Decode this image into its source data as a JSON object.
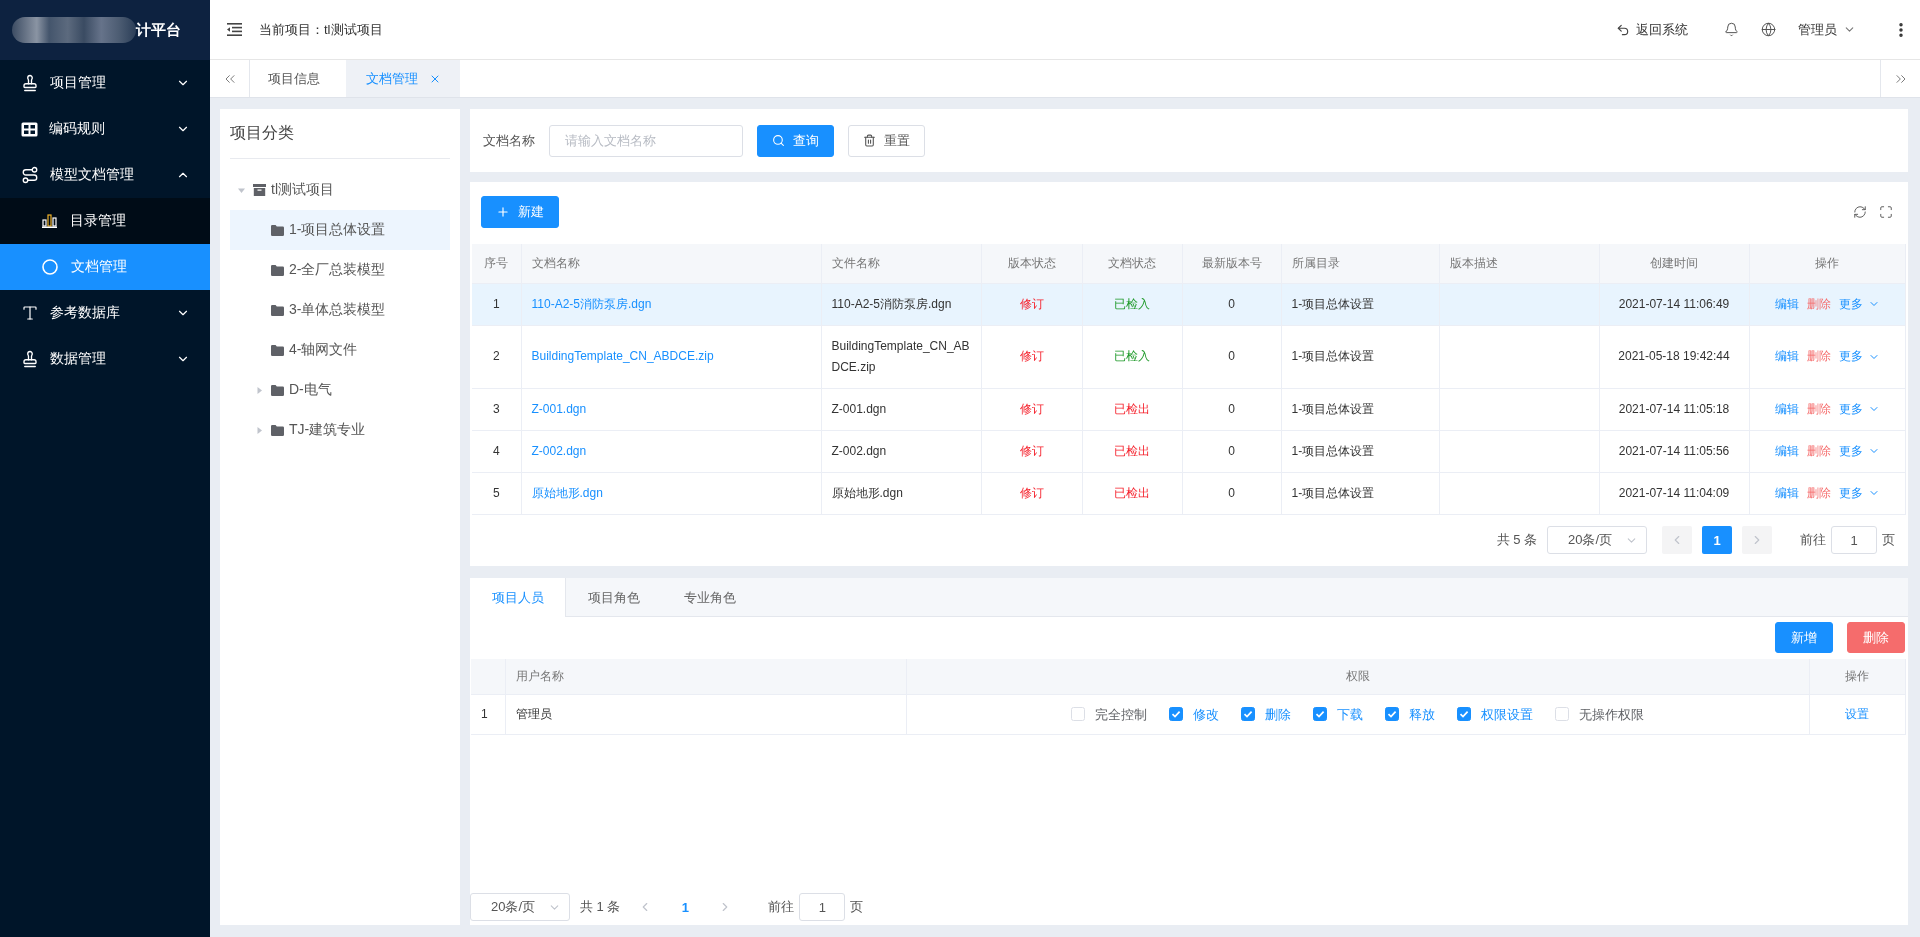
{
  "sidebar": {
    "logo_text": "计平台",
    "menu": [
      {
        "label": "项目管理",
        "expanded": false,
        "selected": false
      },
      {
        "label": "编码规则",
        "expanded": false,
        "selected": false
      },
      {
        "label": "模型文档管理",
        "expanded": true,
        "selected": false,
        "children": [
          {
            "label": "目录管理",
            "selected": false
          },
          {
            "label": "文档管理",
            "selected": true
          }
        ]
      },
      {
        "label": "参考数据库",
        "expanded": false,
        "selected": false
      },
      {
        "label": "数据管理",
        "expanded": false,
        "selected": false
      }
    ]
  },
  "header": {
    "current_project": "当前项目：tl测试项目",
    "back_link": "返回系统",
    "user": "管理员"
  },
  "tabs": [
    {
      "label": "项目信息",
      "selected": false,
      "closable": false
    },
    {
      "label": "文档管理",
      "selected": true,
      "closable": true
    }
  ],
  "tree_panel": {
    "title": "项目分类",
    "tree": [
      {
        "label": "tl测试项目",
        "expanded": true,
        "selected": false,
        "children": [
          {
            "label": "1-项目总体设置",
            "selected": true
          },
          {
            "label": "2-全厂总装模型",
            "selected": false
          },
          {
            "label": "3-单体总装模型",
            "selected": false
          },
          {
            "label": "4-轴网文件",
            "selected": false
          },
          {
            "label": "D-电气",
            "selected": false,
            "expanded": false
          },
          {
            "label": "TJ-建筑专业",
            "selected": false,
            "expanded": false
          }
        ]
      }
    ]
  },
  "search": {
    "label": "文档名称",
    "placeholder": "请输入文档名称",
    "buttons": [
      {
        "label": "查询",
        "kind": "primary"
      },
      {
        "label": "重置",
        "kind": "default"
      }
    ]
  },
  "documents": {
    "new_button": "新建",
    "columns": [
      "序号",
      "文档名称",
      "文件名称",
      "版本状态",
      "文档状态",
      "最新版本号",
      "所属目录",
      "版本描述",
      "创建时间",
      "操作"
    ],
    "rows": [
      {
        "index": "1",
        "doc_name": "110-A2-5消防泵房.dgn",
        "file_name": "110-A2-5消防泵房.dgn",
        "version_status": "修订",
        "doc_status": {
          "text": "已检入",
          "color": "#1f9a2a"
        },
        "latest_version": "0",
        "directory": "1-项目总体设置",
        "created": "2021-07-14 11:06:49",
        "actions": [
          {
            "label": "编辑",
            "kind": "edit"
          },
          {
            "label": "删除",
            "kind": "delete"
          },
          {
            "label": "更多",
            "kind": "more"
          }
        ],
        "selected": true
      },
      {
        "index": "2",
        "doc_name": "BuildingTemplate_CN_ABDCE.zip",
        "file_name": "BuildingTemplate_CN_ABDCE.zip",
        "version_status": "修订",
        "doc_status": {
          "text": "已检入",
          "color": "#1f9a2a"
        },
        "latest_version": "0",
        "directory": "1-项目总体设置",
        "created": "2021-05-18 19:42:44",
        "actions": [
          {
            "label": "编辑",
            "kind": "edit"
          },
          {
            "label": "删除",
            "kind": "delete"
          },
          {
            "label": "更多",
            "kind": "more"
          }
        ],
        "selected": false
      },
      {
        "index": "3",
        "doc_name": "Z-001.dgn",
        "file_name": "Z-001.dgn",
        "version_status": "修订",
        "doc_status": {
          "text": "已检出",
          "color": "#f5222d"
        },
        "latest_version": "0",
        "directory": "1-项目总体设置",
        "created": "2021-07-14 11:05:18",
        "actions": [
          {
            "label": "编辑",
            "kind": "edit"
          },
          {
            "label": "删除",
            "kind": "delete"
          },
          {
            "label": "更多",
            "kind": "more"
          }
        ],
        "selected": false
      },
      {
        "index": "4",
        "doc_name": "Z-002.dgn",
        "file_name": "Z-002.dgn",
        "version_status": "修订",
        "doc_status": {
          "text": "已检出",
          "color": "#f5222d"
        },
        "latest_version": "0",
        "directory": "1-项目总体设置",
        "created": "2021-07-14 11:05:56",
        "actions": [
          {
            "label": "编辑",
            "kind": "edit"
          },
          {
            "label": "删除",
            "kind": "delete"
          },
          {
            "label": "更多",
            "kind": "more"
          }
        ],
        "selected": false
      },
      {
        "index": "5",
        "doc_name": "原始地形.dgn",
        "file_name": "原始地形.dgn",
        "version_status": "修订",
        "doc_status": {
          "text": "已检出",
          "color": "#f5222d"
        },
        "latest_version": "0",
        "directory": "1-项目总体设置",
        "created": "2021-07-14 11:04:09",
        "actions": [
          {
            "label": "编辑",
            "kind": "edit"
          },
          {
            "label": "删除",
            "kind": "delete"
          },
          {
            "label": "更多",
            "kind": "more"
          }
        ],
        "selected": false
      }
    ],
    "pagination": {
      "background": true,
      "items": [
        {
          "kind": "total",
          "text": "共 5 条"
        },
        {
          "kind": "sizes",
          "text": "20条/页"
        },
        {
          "kind": "pager",
          "pages": [
            {
              "label": "1",
              "selected": true
            }
          ]
        },
        {
          "kind": "jumper",
          "label": "前往",
          "value": "1",
          "suffix": "页"
        }
      ]
    }
  },
  "members": {
    "tabs": [
      {
        "label": "项目人员",
        "selected": true
      },
      {
        "label": "项目角色",
        "selected": false
      },
      {
        "label": "专业角色",
        "selected": false
      }
    ],
    "buttons": [
      {
        "label": "新增",
        "kind": "primary"
      },
      {
        "label": "删除",
        "kind": "danger"
      }
    ],
    "columns": [
      "用户名称",
      "权限",
      "操作"
    ],
    "rows": [
      {
        "index": "1",
        "name": "管理员",
        "permissions": [
          {
            "label": "完全控制",
            "checked": false
          },
          {
            "label": "修改",
            "checked": true
          },
          {
            "label": "删除",
            "checked": true
          },
          {
            "label": "下载",
            "checked": true
          },
          {
            "label": "释放",
            "checked": true
          },
          {
            "label": "权限设置",
            "checked": true
          },
          {
            "label": "无操作权限",
            "checked": false
          }
        ],
        "action": "设置"
      }
    ],
    "pagination": {
      "background": false,
      "items": [
        {
          "kind": "sizes",
          "text": "20条/页"
        },
        {
          "kind": "total",
          "text": "共 1 条"
        },
        {
          "kind": "pager",
          "pages": [
            {
              "label": "1",
              "selected": true
            }
          ]
        },
        {
          "kind": "jumper",
          "label": "前往",
          "value": "1",
          "suffix": "页"
        }
      ]
    }
  }
}
